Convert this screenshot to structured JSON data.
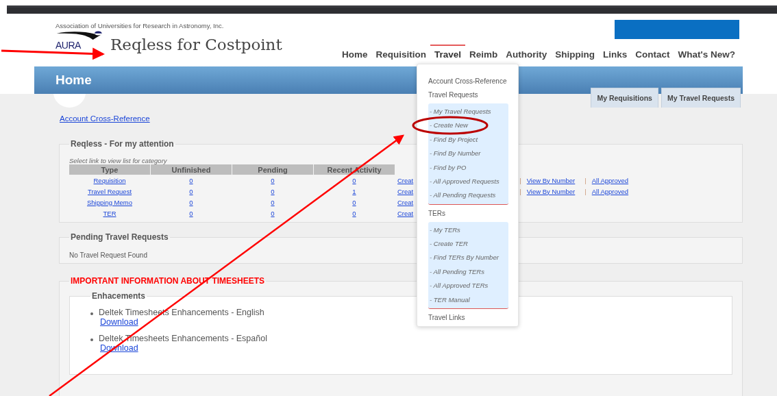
{
  "org_name": "Association of Universities for Research in Astronomy, Inc.",
  "logo_text": "AURA",
  "app_title": "Reqless for Costpoint",
  "nav": [
    {
      "label": "Home",
      "selected": false
    },
    {
      "label": "Requisition",
      "selected": false
    },
    {
      "label": "Travel",
      "selected": true
    },
    {
      "label": "Reimb",
      "selected": false
    },
    {
      "label": "Authority",
      "selected": false
    },
    {
      "label": "Shipping",
      "selected": false
    },
    {
      "label": "Links",
      "selected": false
    },
    {
      "label": "Contact",
      "selected": false
    },
    {
      "label": "What's New?",
      "selected": false
    }
  ],
  "banner_title": "Home",
  "tabs": [
    {
      "label": "My Requisitions"
    },
    {
      "label": "My Travel Requests"
    }
  ],
  "account_link": "Account Cross-Reference",
  "attention": {
    "title": "Reqless - For my attention",
    "hint": "Select link to view list for category",
    "separator": "|",
    "columns": [
      "Type",
      "Unfinished",
      "Pending",
      "Recent Activity"
    ],
    "rows": [
      {
        "type": "Requisition",
        "unfinished": "0",
        "pending": "0",
        "recent": "0",
        "create": "Creat",
        "links": [
          "View By Number",
          "All Approved"
        ]
      },
      {
        "type": "Travel Request",
        "unfinished": "0",
        "pending": "0",
        "recent": "1",
        "create": "Creat",
        "links": [
          "View By Number",
          "All Approved"
        ]
      },
      {
        "type": "Shipping Memo",
        "unfinished": "0",
        "pending": "0",
        "recent": "0",
        "create": "Creat",
        "links": []
      },
      {
        "type": "TER",
        "unfinished": "0",
        "pending": "0",
        "recent": "0",
        "create": "Creat",
        "links": []
      }
    ]
  },
  "pending": {
    "title": "Pending Travel Requests",
    "message": "No Travel Request Found"
  },
  "timesheets": {
    "title": "IMPORTANT INFORMATION ABOUT TIMESHEETS",
    "subtitle": "Enhacements",
    "items": [
      {
        "text": "Deltek Timesheets Enhancements - English",
        "link": "Download"
      },
      {
        "text": "Deltek Timesheets Enhancements - Español",
        "link": "Download"
      }
    ]
  },
  "travel_menu": [
    {
      "kind": "link",
      "label": "Account Cross-Reference"
    },
    {
      "kind": "group",
      "label": "Travel Requests",
      "items": [
        "- My Travel Requests",
        "- Create New",
        "- Find By Project",
        "- Find By Number",
        "- Find by PO",
        "- All Approved Requests",
        "- All Pending Requests"
      ]
    },
    {
      "kind": "group",
      "label": "TERs",
      "items": [
        "- My TERs",
        "- Create TER",
        "- Find TERs By Number",
        "- All Pending TERs",
        "- All Approved TERs",
        "- TER Manual"
      ]
    },
    {
      "kind": "link",
      "label": "Travel Links"
    }
  ]
}
